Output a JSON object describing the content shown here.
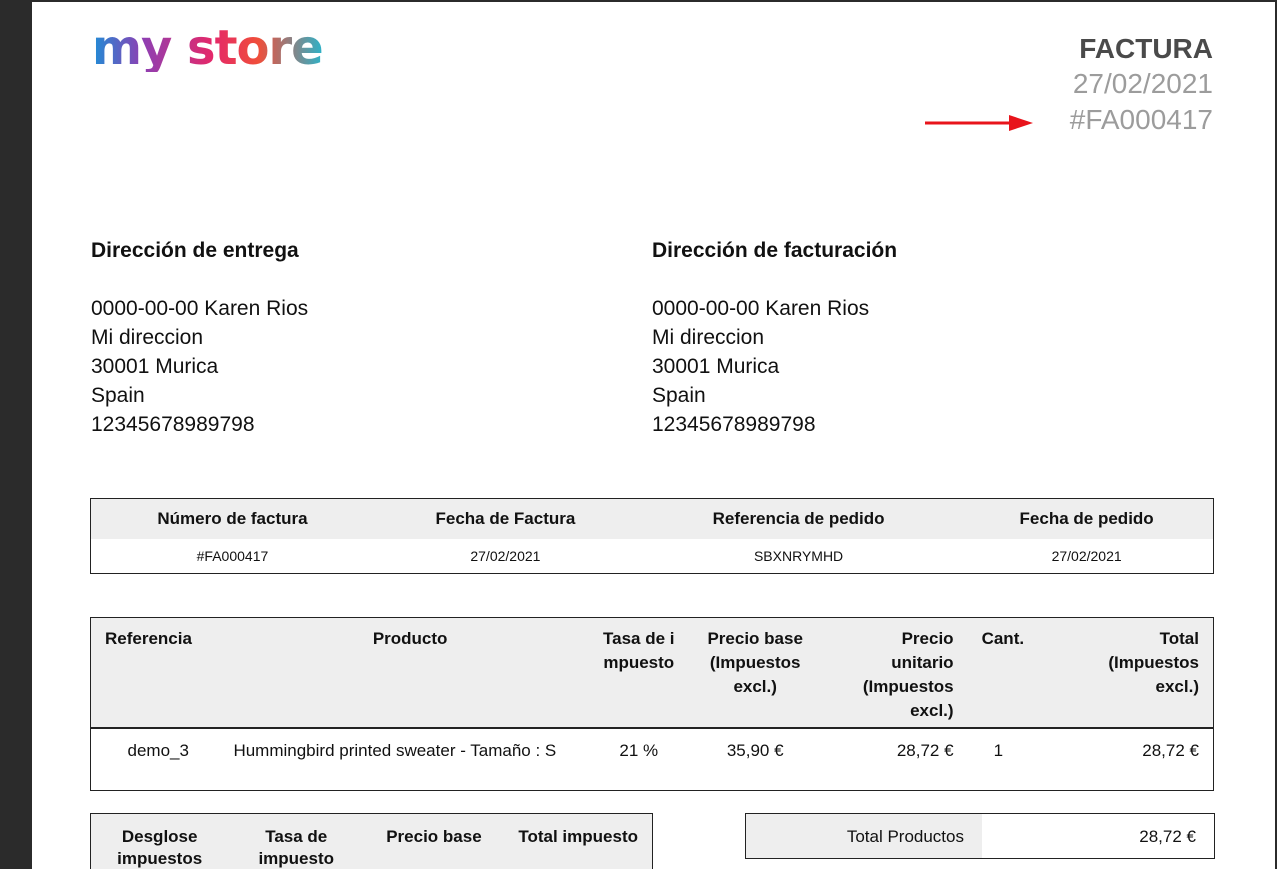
{
  "logo": {
    "text": "my store"
  },
  "invoice_header": {
    "title": "FACTURA",
    "date": "27/02/2021",
    "number": "#FA000417"
  },
  "delivery_address": {
    "title": "Dirección de entrega",
    "lines": [
      "0000-00-00 Karen Rios",
      "Mi direccion",
      "30001 Murica",
      "Spain",
      "12345678989798"
    ]
  },
  "billing_address": {
    "title": "Dirección de facturación",
    "lines": [
      "0000-00-00 Karen Rios",
      "Mi direccion",
      "30001 Murica",
      "Spain",
      "12345678989798"
    ]
  },
  "summary_table": {
    "headers": [
      "Número de factura",
      "Fecha de Factura",
      "Referencia de pedido",
      "Fecha de pedido"
    ],
    "row": [
      "#FA000417",
      "27/02/2021",
      "SBXNRYMHD",
      "27/02/2021"
    ]
  },
  "products_table": {
    "headers": {
      "reference": "Referencia",
      "product": "Producto",
      "tax_rate": "Tasa de impuesto",
      "base_price": "Precio base (Impuestos excl.)",
      "unit_price": "Precio unitario (Impuestos excl.)",
      "qty": "Cant.",
      "total": "Total (Impuestos excl.)"
    },
    "rows": [
      {
        "reference": "demo_3",
        "product": "Hummingbird printed sweater - Tamaño : S",
        "tax_rate": "21 %",
        "base_price": "35,90 €",
        "unit_price": "28,72 €",
        "qty": "1",
        "total": "28,72 €"
      }
    ]
  },
  "tax_table": {
    "headers": [
      "Desglose impuestos",
      "Tasa de impuesto",
      "Precio base",
      "Total impuesto"
    ]
  },
  "totals_table": {
    "rows": [
      {
        "label": "Total Productos",
        "value": "28,72 €"
      }
    ]
  },
  "colors": {
    "arrow": "#e8141b",
    "header_bg": "#eeeeee",
    "muted_text": "#9c9c9c"
  }
}
